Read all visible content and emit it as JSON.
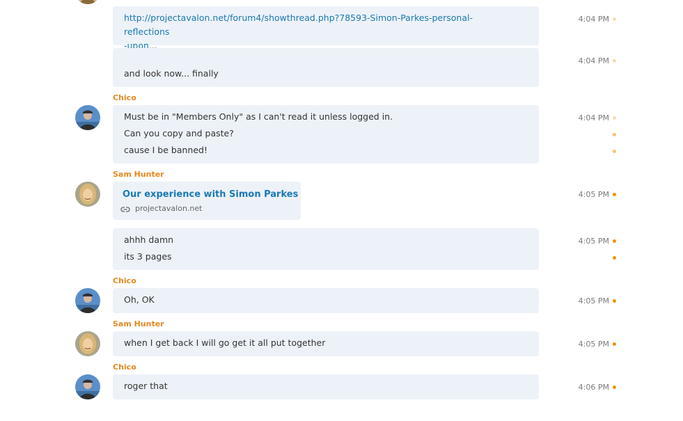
{
  "conversation": {
    "senders": {
      "chico": "Chico",
      "sam": "Sam Hunter"
    },
    "messages": [
      {
        "link_text": "http://projectavalon.net/forum4/showthread.php?78593-Simon-Parkes-personal-reflections",
        "link_text_cont": "-upon",
        "ellipsis": "...",
        "time": "4:04 PM"
      },
      {
        "text": "and look now... finally",
        "time": "4:04 PM"
      },
      {
        "lines": [
          "Must be in \"Members Only\" as I can't read it unless logged in.",
          "Can you copy and paste?",
          "cause I be banned!"
        ],
        "time": "4:04 PM"
      },
      {
        "card_title": "Our experience with Simon Parkes",
        "card_domain": "projectavalon.net",
        "time": "4:05 PM"
      },
      {
        "lines": [
          "ahhh damn",
          "its 3 pages"
        ],
        "time": "4:05 PM"
      },
      {
        "text": "Oh, OK",
        "time": "4:05 PM"
      },
      {
        "text": "when I get back I will go get it all put together",
        "time": "4:05 PM"
      },
      {
        "text": "roger that",
        "time": "4:06 PM"
      }
    ]
  },
  "colors": {
    "bubble": "#edf2f8",
    "sender": "#e8871e",
    "link": "#1b79b4",
    "status_dot_delivered": "#f4c46e",
    "status_dot_sent": "#f39200",
    "status_dot_faded": "#f7dcae"
  },
  "icons": {
    "link": "link-chain-icon",
    "status": "status-dot-icon"
  }
}
